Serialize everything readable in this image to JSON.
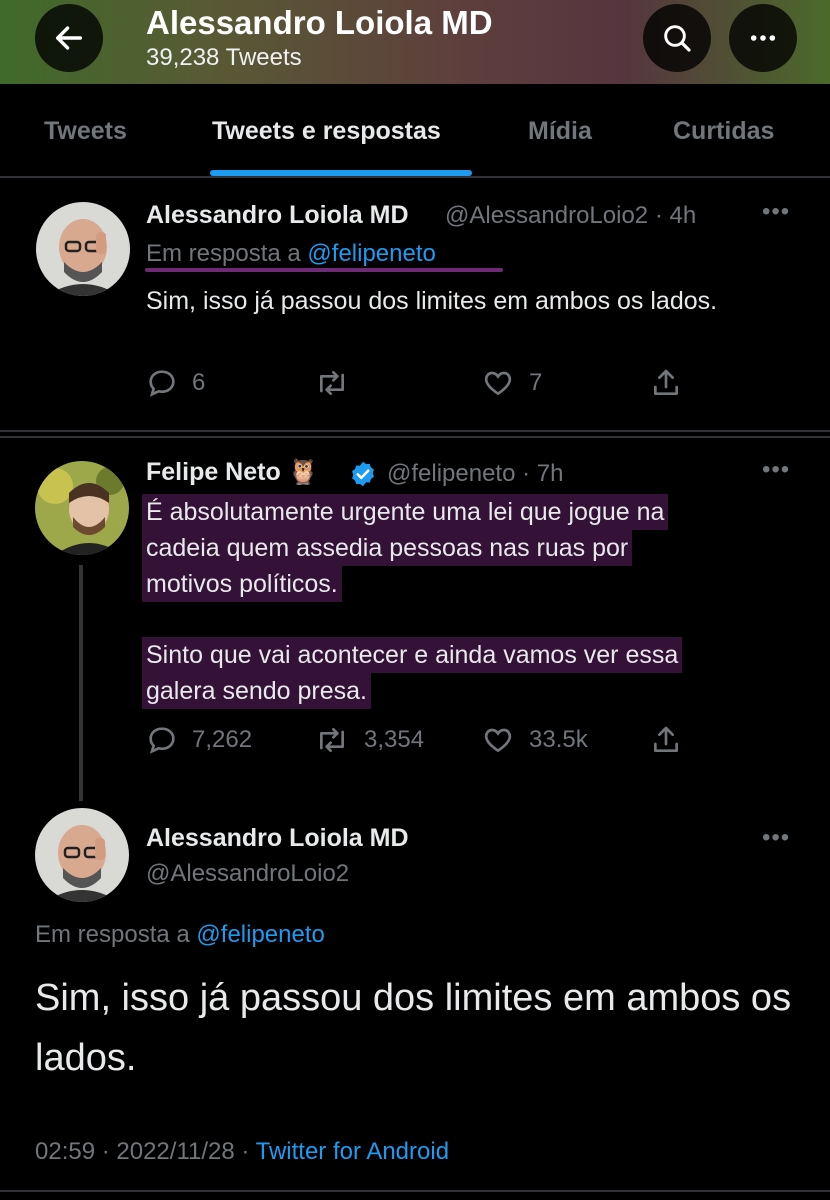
{
  "header": {
    "title": "Alessandro Loiola MD",
    "subtitle": "39,238 Tweets"
  },
  "tabs": [
    {
      "label": "Tweets",
      "active": false
    },
    {
      "label": "Tweets e respostas",
      "active": true
    },
    {
      "label": "Mídia",
      "active": false
    },
    {
      "label": "Curtidas",
      "active": false
    }
  ],
  "tweet1": {
    "name": "Alessandro Loiola MD",
    "handle_time": "@AlessandroLoio2 · 4h",
    "reply_prefix": "Em resposta a",
    "reply_handle": "@felipeneto",
    "text": "Sim, isso já passou dos limites em ambos os lados.",
    "replies": "6",
    "retweets": "",
    "likes": "7"
  },
  "tweet2": {
    "name": "Felipe Neto",
    "emoji": "🦉",
    "handle_time": "@felipeneto · 7h",
    "text_line1": "É absolutamente urgente uma lei que jogue na",
    "text_line2": "cadeia quem assedia pessoas nas ruas por",
    "text_line3": "motivos políticos.",
    "text_line4": "Sinto que vai acontecer e ainda vamos ver essa",
    "text_line5": "galera sendo presa.",
    "replies": "7,262",
    "retweets": "3,354",
    "likes": "33.5k"
  },
  "tweet3": {
    "name": "Alessandro Loiola MD",
    "handle": "@AlessandroLoio2",
    "reply_prefix": "Em resposta a",
    "reply_handle": "@felipeneto",
    "text": "Sim, isso já passou dos limites em ambos os lados.",
    "time_date": "02:59 · 2022/11/28 ·",
    "source": "Twitter for Android"
  },
  "colors": {
    "accent": "#1d9bf0",
    "highlight": "#7d2882",
    "muted": "#71767b"
  },
  "icons": [
    "back-arrow-icon",
    "search-icon",
    "more-icon",
    "reply-icon",
    "retweet-icon",
    "like-icon",
    "share-icon",
    "verified-badge-icon"
  ]
}
